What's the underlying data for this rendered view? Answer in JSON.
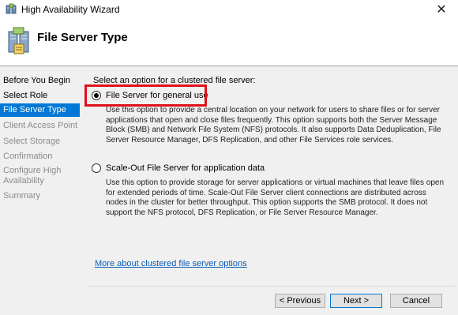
{
  "window": {
    "title": "High Availability Wizard",
    "close_glyph": "✕"
  },
  "header": {
    "title": "File Server Type",
    "icon": "cluster-file-server-icon"
  },
  "sidebar": {
    "items": [
      {
        "label": "Before You Begin",
        "state": "completed"
      },
      {
        "label": "Select Role",
        "state": "completed"
      },
      {
        "label": "File Server Type",
        "state": "current"
      },
      {
        "label": "Client Access Point",
        "state": "disabled"
      },
      {
        "label": "Select Storage",
        "state": "disabled"
      },
      {
        "label": "Confirmation",
        "state": "disabled"
      },
      {
        "label": "Configure High Availability",
        "state": "disabled"
      },
      {
        "label": "Summary",
        "state": "disabled"
      }
    ]
  },
  "content": {
    "prompt": "Select an option for a clustered file server:",
    "options": [
      {
        "label": "File Server for general use",
        "checked": true,
        "description": "Use this option to provide a central location on your network for users to share files or for server applications that open and close files frequently. This option supports both the Server Message Block (SMB) and Network File System (NFS) protocols. It also supports Data Deduplication, File Server Resource Manager, DFS Replication, and other File Services role services."
      },
      {
        "label": "Scale-Out File Server for application data",
        "checked": false,
        "description": "Use this option to provide storage for server applications or virtual machines that leave files open for extended periods of time. Scale-Out File Server client connections are distributed across nodes in the cluster for better throughput. This option supports the SMB protocol. It does not support the NFS protocol, DFS Replication, or File Server Resource Manager."
      }
    ],
    "link": "More about clustered file server options"
  },
  "footer": {
    "previous_label": "< Previous",
    "next_label": "Next >",
    "cancel_label": "Cancel"
  },
  "colors": {
    "accent": "#0078d7",
    "highlight_box": "#e0101a",
    "link": "#0b5cb5"
  }
}
